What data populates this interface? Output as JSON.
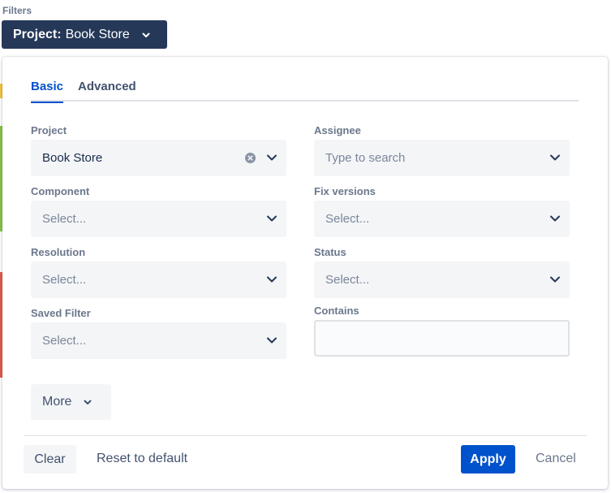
{
  "filters_label": "Filters",
  "project_trigger": {
    "key": "Project:",
    "value": "Book Store"
  },
  "tabs": [
    {
      "label": "Basic",
      "active": true
    },
    {
      "label": "Advanced",
      "active": false
    }
  ],
  "fields": {
    "project": {
      "label": "Project",
      "value": "Book Store"
    },
    "assignee": {
      "label": "Assignee",
      "placeholder": "Type to search"
    },
    "component": {
      "label": "Component",
      "placeholder": "Select..."
    },
    "fix_versions": {
      "label": "Fix versions",
      "placeholder": "Select..."
    },
    "resolution": {
      "label": "Resolution",
      "placeholder": "Select..."
    },
    "status": {
      "label": "Status",
      "placeholder": "Select..."
    },
    "saved_filter": {
      "label": "Saved Filter",
      "placeholder": "Select..."
    },
    "contains": {
      "label": "Contains",
      "value": ""
    }
  },
  "more_label": "More",
  "footer": {
    "clear": "Clear",
    "reset": "Reset to default",
    "apply": "Apply",
    "cancel": "Cancel"
  },
  "colors": {
    "primary": "#0052cc",
    "trigger_bg": "#253858",
    "field_bg": "#f4f5f7"
  }
}
